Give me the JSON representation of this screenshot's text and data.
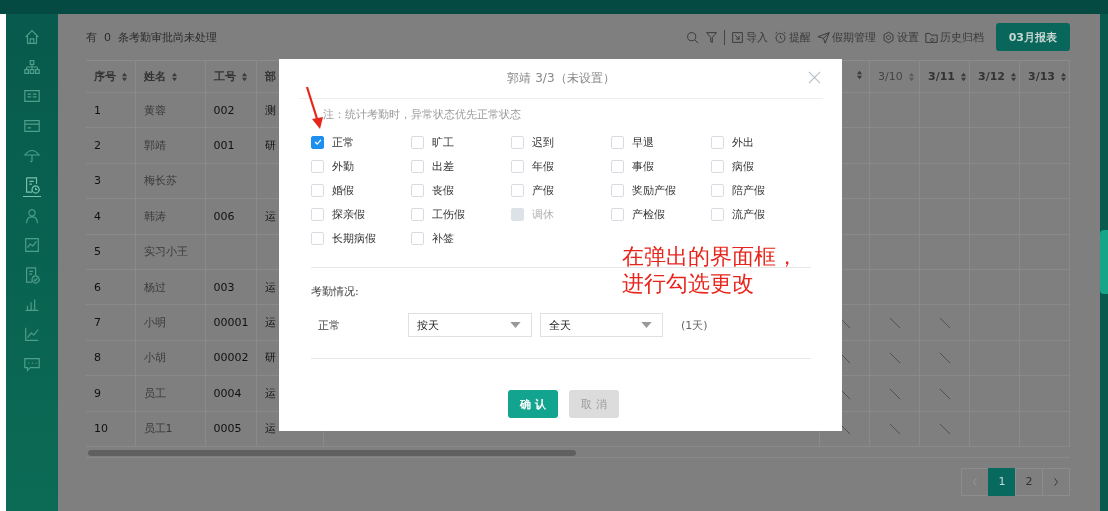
{
  "sidebar": {
    "items": [
      {
        "selected": false
      },
      {
        "selected": false
      },
      {
        "selected": false
      },
      {
        "selected": false
      },
      {
        "selected": false
      },
      {
        "selected": true
      },
      {
        "selected": false
      },
      {
        "selected": false
      },
      {
        "selected": false
      },
      {
        "selected": false
      },
      {
        "selected": false
      },
      {
        "selected": false
      }
    ]
  },
  "notice": {
    "prefix": "有",
    "count": "0",
    "text": "条考勤审批尚未处理"
  },
  "toolbar": {
    "tools": [
      {
        "kind": "search"
      },
      {
        "kind": "filter"
      },
      {
        "kind": "import",
        "label": "导入"
      },
      {
        "kind": "alarm",
        "label": "提醒"
      },
      {
        "kind": "plane",
        "label": "假期管理"
      },
      {
        "kind": "gear",
        "label": "设置"
      },
      {
        "kind": "folder",
        "label": "历史归档"
      }
    ],
    "report_button": "03月报表"
  },
  "table": {
    "columns": [
      {
        "label": "序号"
      },
      {
        "label": "姓名"
      },
      {
        "label": "工号"
      },
      {
        "label": "部"
      }
    ],
    "day_columns": [
      {},
      {
        "label": "3/10",
        "muted": true
      },
      {
        "label": "3/11",
        "muted": false
      },
      {
        "label": "3/12",
        "muted": false
      },
      {
        "label": "3/13",
        "muted": false
      }
    ],
    "rows": [
      {
        "no": "1",
        "name": "黄蓉",
        "id": "002",
        "dept": "测",
        "marks": [
          false,
          false,
          false,
          false,
          false
        ]
      },
      {
        "no": "2",
        "name": "郭靖",
        "id": "001",
        "dept": "研",
        "marks": [
          false,
          false,
          false,
          false,
          false
        ]
      },
      {
        "no": "3",
        "name": "梅长苏",
        "marks": [
          false,
          false,
          false,
          false,
          false
        ]
      },
      {
        "no": "4",
        "name": "韩涛",
        "id": "006",
        "dept": "运",
        "marks": [
          false,
          false,
          false,
          false,
          false
        ]
      },
      {
        "no": "5",
        "name": "实习小王",
        "marks": [
          false,
          false,
          false,
          false,
          false
        ]
      },
      {
        "no": "6",
        "name": "杨过",
        "id": "003",
        "dept": "运",
        "marks": [
          false,
          false,
          false,
          false,
          false
        ]
      },
      {
        "no": "7",
        "name": "小明",
        "id": "00001",
        "dept": "运",
        "marks": [
          true,
          true,
          true,
          false,
          false
        ]
      },
      {
        "no": "8",
        "name": "小胡",
        "id": "00002",
        "dept": "研",
        "marks": [
          true,
          true,
          true,
          false,
          false
        ]
      },
      {
        "no": "9",
        "name": "员工",
        "id": "0004",
        "dept": "运",
        "marks": [
          true,
          true,
          true,
          false,
          false
        ]
      },
      {
        "no": "10",
        "name": "员工1",
        "id": "0005",
        "dept": "运",
        "marks": [
          true,
          true,
          true,
          false,
          false
        ]
      }
    ]
  },
  "pagination": {
    "prev_disabled": true,
    "pages": [
      {
        "label": "1",
        "selected": true
      },
      {
        "label": "2",
        "selected": false
      }
    ]
  },
  "dialog": {
    "title": "郭靖 3/3（未设置）",
    "note": "注：统计考勤时，异常状态优先正常状态",
    "options": [
      {
        "label": "正常",
        "checked": true,
        "disabled": false
      },
      {
        "label": "旷工",
        "checked": false,
        "disabled": false
      },
      {
        "label": "迟到",
        "checked": false,
        "disabled": false
      },
      {
        "label": "早退",
        "checked": false,
        "disabled": false
      },
      {
        "label": "外出",
        "checked": false,
        "disabled": false
      },
      {
        "label": "外勤",
        "checked": false,
        "disabled": false
      },
      {
        "label": "出差",
        "checked": false,
        "disabled": false
      },
      {
        "label": "年假",
        "checked": false,
        "disabled": false
      },
      {
        "label": "事假",
        "checked": false,
        "disabled": false
      },
      {
        "label": "病假",
        "checked": false,
        "disabled": false
      },
      {
        "label": "婚假",
        "checked": false,
        "disabled": false
      },
      {
        "label": "丧假",
        "checked": false,
        "disabled": false
      },
      {
        "label": "产假",
        "checked": false,
        "disabled": false
      },
      {
        "label": "奖励产假",
        "checked": false,
        "disabled": false
      },
      {
        "label": "陪产假",
        "checked": false,
        "disabled": false
      },
      {
        "label": "探亲假",
        "checked": false,
        "disabled": false
      },
      {
        "label": "工伤假",
        "checked": false,
        "disabled": false
      },
      {
        "label": "调休",
        "checked": false,
        "disabled": true
      },
      {
        "label": "产检假",
        "checked": false,
        "disabled": false
      },
      {
        "label": "流产假",
        "checked": false,
        "disabled": false
      },
      {
        "label": "长期病假",
        "checked": false,
        "disabled": false
      },
      {
        "label": "补签",
        "checked": false,
        "disabled": false
      }
    ],
    "section_label": "考勤情况:",
    "status": "正常",
    "unit_select": "按天",
    "period_select": "全天",
    "duration": "(1天)",
    "confirm": "确 认",
    "cancel": "取 消"
  },
  "annotation": {
    "lines": [
      "在弹出的界面框，",
      "进行勾选更改"
    ]
  }
}
